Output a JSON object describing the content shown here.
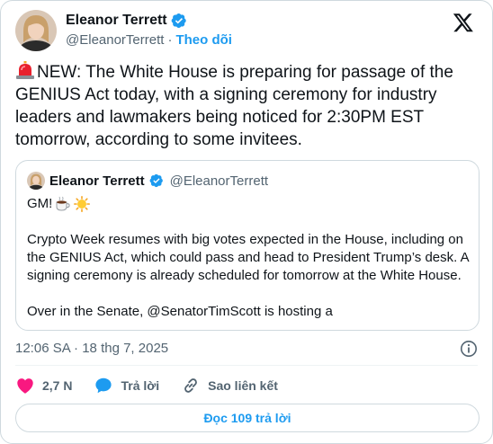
{
  "author": {
    "name": "Eleanor Terrett",
    "handle": "@EleanorTerrett",
    "separator": "·",
    "follow_label": "Theo dõi"
  },
  "tweet": {
    "text": "NEW: The White House is preparing for passage of the GENIUS Act today, with a signing ceremony for industry leaders and lawmakers being noticed for 2:30PM EST tomorrow, according to some invitees.",
    "timestamp": "12:06 SA · 18 thg 7, 2025"
  },
  "quoted": {
    "name": "Eleanor Terrett",
    "handle": "@EleanorTerrett",
    "line1": "GM!",
    "para1": "Crypto Week resumes with big votes expected in the House, including on the GENIUS Act, which could pass and head to President Trump’s desk. A signing ceremony is already scheduled for tomorrow at the White House.",
    "para2": "Over in the Senate, @SenatorTimScott is hosting a"
  },
  "actions": {
    "likes": "2,7 N",
    "reply_label": "Trả lời",
    "copy_link_label": "Sao liên kết"
  },
  "replies_button": "Đọc 109 trả lời",
  "colors": {
    "accent": "#1d9bf0",
    "like": "#f91880",
    "text": "#0f1419",
    "muted": "#536471",
    "border": "#cfd9de"
  },
  "icons": [
    "verified-badge-icon",
    "x-logo-icon",
    "siren-emoji-icon",
    "coffee-emoji-icon",
    "sun-emoji-icon",
    "info-icon",
    "heart-icon",
    "reply-bubble-icon",
    "link-icon"
  ]
}
